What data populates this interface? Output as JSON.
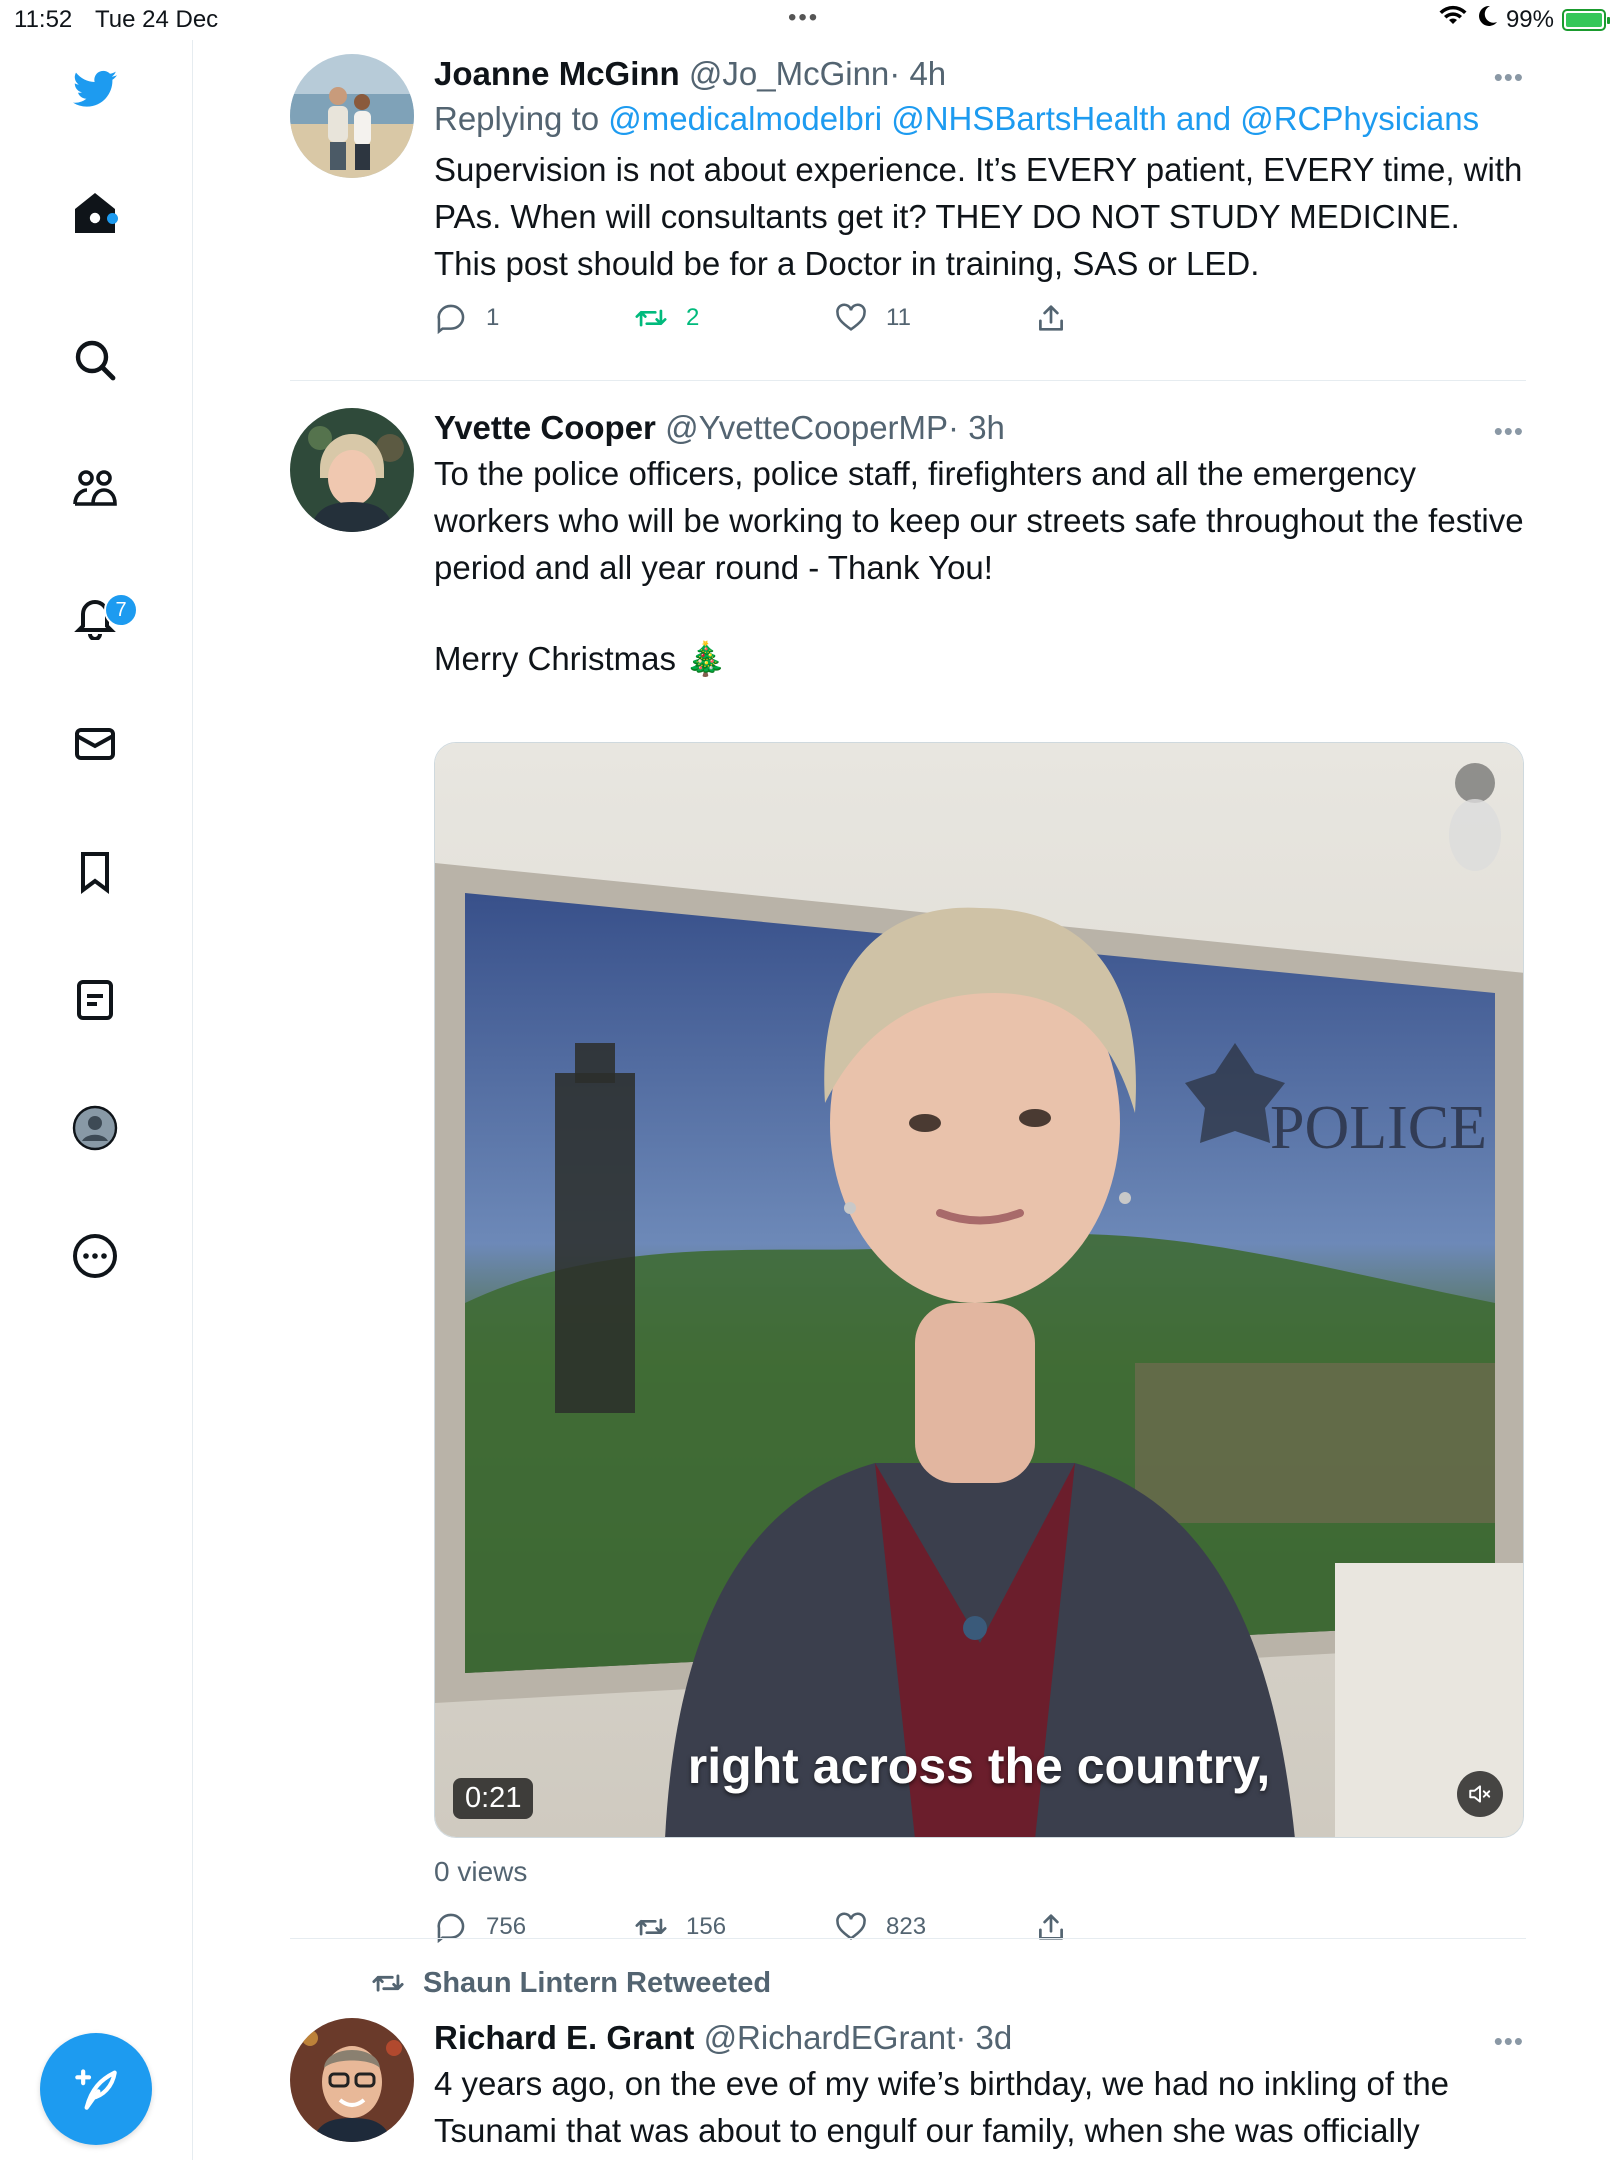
{
  "status_bar": {
    "time": "11:52",
    "date": "Tue 24 Dec",
    "battery": "99%",
    "battery_level": 0.99,
    "multitask_dots": "•••"
  },
  "sidebar": {
    "items": [
      {
        "name": "twitter-logo-icon"
      },
      {
        "name": "home-icon"
      },
      {
        "name": "search-icon"
      },
      {
        "name": "communities-icon"
      },
      {
        "name": "notifications-icon"
      },
      {
        "name": "messages-icon"
      },
      {
        "name": "bookmarks-icon"
      },
      {
        "name": "lists-icon"
      },
      {
        "name": "profile-icon"
      },
      {
        "name": "more-icon"
      }
    ],
    "notifications_badge": "7",
    "accent": "#1d9bf0"
  },
  "tweets": [
    {
      "name": "Joanne McGinn",
      "handle": "@Jo_McGinn",
      "time": "· 4h",
      "replying_to_label": "Replying to",
      "reply_mentions": [
        "@medicalmodelbri",
        "@NHSBartsHealth",
        "@RCPhysicians"
      ],
      "reply_and": "and",
      "text": "Supervision is not about experience. It’s EVERY patient, EVERY time, with PAs. When will consultants get it? THEY DO NOT STUDY MEDICINE. This post should be for a Doctor in training, SAS or LED.",
      "replies": "1",
      "retweets": "2",
      "likes": "11",
      "more": "•••"
    },
    {
      "name": "Yvette Cooper",
      "handle": "@YvetteCooperMP",
      "time": "· 3h",
      "text": "To the police officers, police staff, firefighters and all the emergency workers who will be working to keep our streets safe throughout the festive period and all year round - Thank You!",
      "text2": "Merry Christmas 🎄",
      "video": {
        "caption": "right across the country,",
        "duration": "0:21",
        "sign_text": "POLICE"
      },
      "views": "0 views",
      "replies": "756",
      "retweets": "156",
      "likes": "823",
      "more": "•••"
    },
    {
      "retweeted_by": "Shaun Lintern Retweeted",
      "name": "Richard E. Grant",
      "handle": "@RichardEGrant",
      "time": "· 3d",
      "text": "4 years ago, on the eve of my wife’s birthday, we had no inkling of the Tsunami that was about to engulf our family, when she was officially",
      "more": "•••"
    }
  ]
}
